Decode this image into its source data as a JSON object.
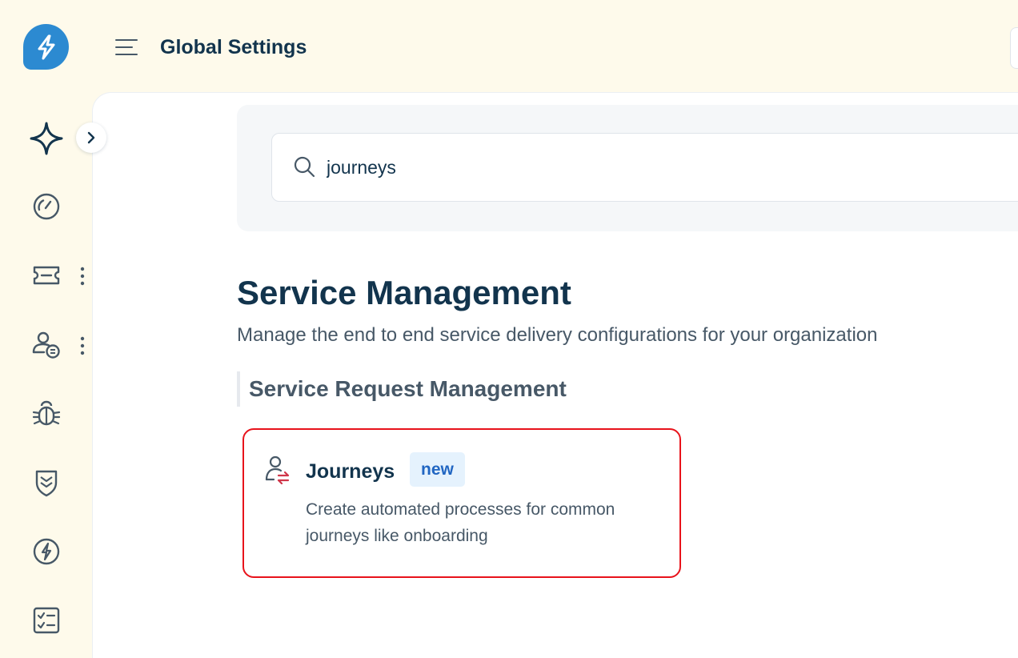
{
  "header": {
    "title": "Global Settings"
  },
  "sidebar": {
    "items": [
      {
        "icon": "sparkle-icon"
      },
      {
        "icon": "dashboard-gauge-icon"
      },
      {
        "icon": "ticket-icon",
        "has_more": true
      },
      {
        "icon": "requester-icon",
        "has_more": true
      },
      {
        "icon": "bug-icon"
      },
      {
        "icon": "shield-icon"
      },
      {
        "icon": "lightning-circle-icon"
      },
      {
        "icon": "checklist-icon"
      }
    ]
  },
  "search": {
    "value": "journeys"
  },
  "main": {
    "section_title": "Service Management",
    "section_description": "Manage the end to end service delivery configurations for your organization",
    "subsection_title": "Service Request Management",
    "card": {
      "title": "Journeys",
      "badge": "new",
      "description": "Create automated processes for common journeys like onboarding"
    }
  },
  "colors": {
    "page_bg": "#fefaeb",
    "brand_blue": "#2c8ad1",
    "text_dark": "#12344d",
    "text_muted": "#475867",
    "highlight_red": "#e8131b",
    "badge_bg": "#e5f2fd",
    "badge_text": "#2166c2"
  }
}
